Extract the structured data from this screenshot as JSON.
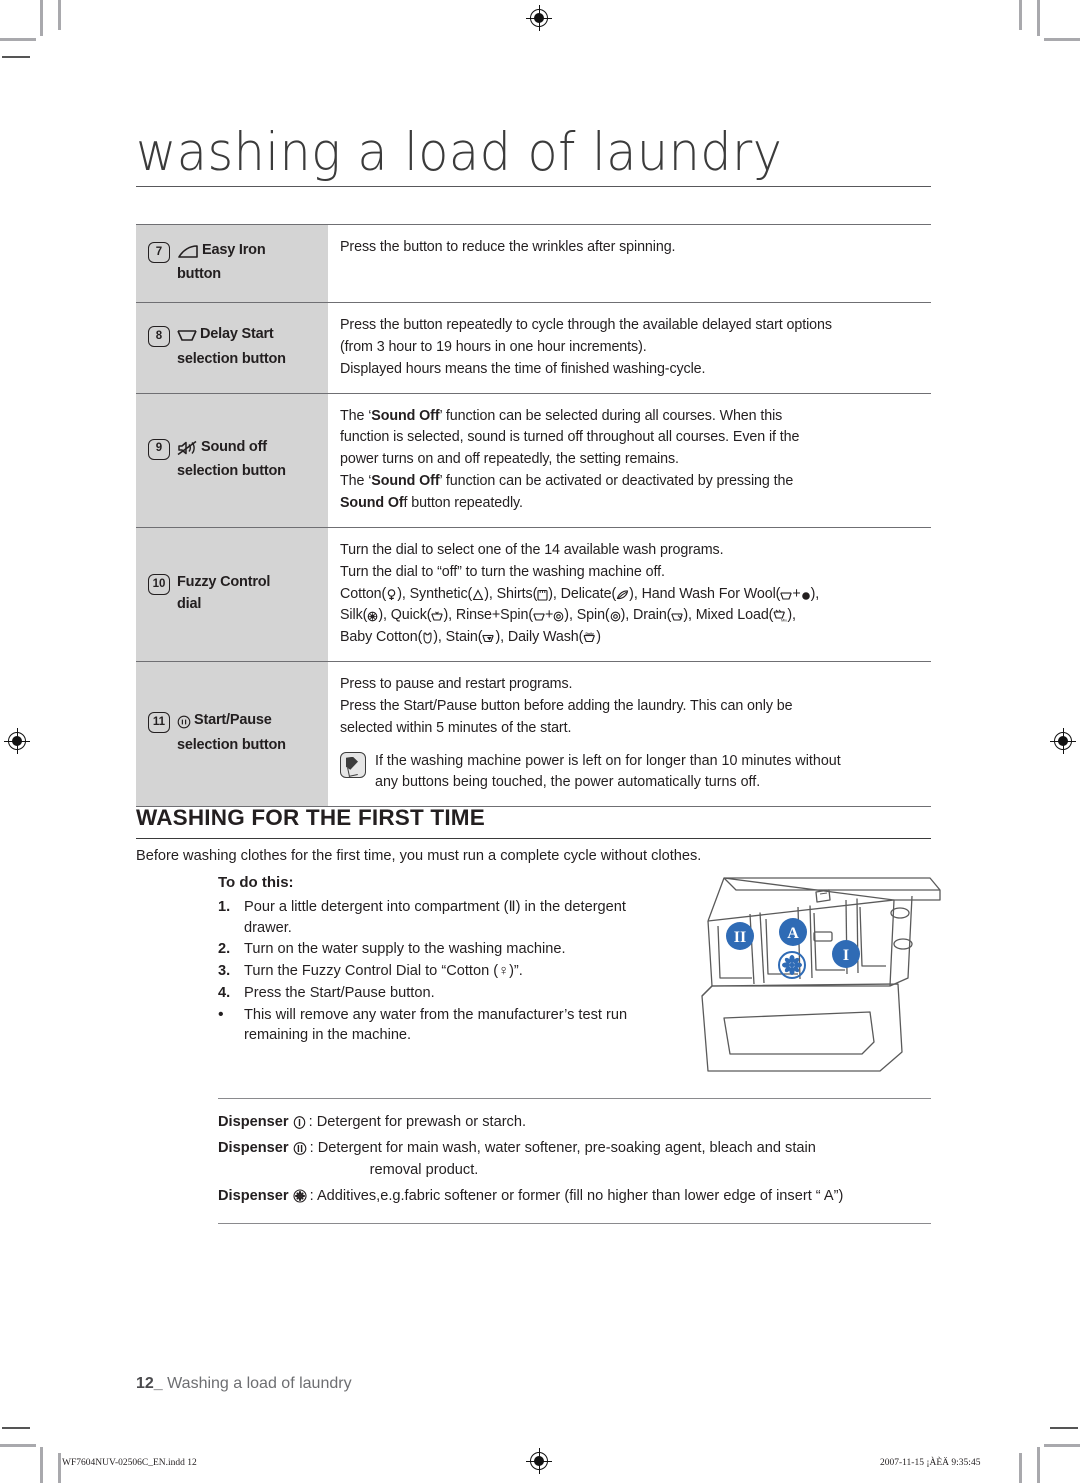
{
  "document": {
    "chapter_title": "washing a load of laundry",
    "folio_page": "12_",
    "folio_text": "Washing a load of laundry",
    "print_filename": "WF7604NUV-02506C_EN.indd   12",
    "print_timestamp": "2007-11-15   ¡ÀÈÄ 9:35:45"
  },
  "button_table": {
    "rows": [
      {
        "number": "7",
        "icon": "iron-icon",
        "label_line1": "Easy Iron",
        "label_line2": "button",
        "lines": [
          "Press the button to reduce the wrinkles after spinning."
        ]
      },
      {
        "number": "8",
        "icon": "delay-start-icon",
        "label_line1": "Delay Start",
        "label_line2": "selection button",
        "lines": [
          "Press the button repeatedly to cycle through the available delayed start options",
          "(from 3 hour to 19 hours in one hour increments).",
          "Displayed hours means the time of finished washing-cycle."
        ]
      },
      {
        "number": "9",
        "icon": "sound-off-icon",
        "label_line1": "Sound off",
        "label_line2": "selection button",
        "rich_lines": [
          "The ‘<b>Sound Off</b>’ function can be selected during all courses. When this",
          "function is selected, sound is turned off throughout all courses. Even if the",
          "power turns on and off repeatedly, the setting remains.",
          "The ‘<b>Sound Off</b>’ function can be activated or deactivated by pressing the",
          "<b>Sound Of</b>f button repeatedly."
        ]
      },
      {
        "number": "10",
        "icon": "",
        "label_line1": "Fuzzy Control",
        "label_line2": "dial",
        "lines": [
          "Turn the dial to select one of the 14 available wash programs.",
          "Turn the dial to “off” to turn the washing machine off."
        ],
        "programs_text": [
          "Cotton(♀), Synthetic(⚳), Shirts(⬜), Delicate(◢), Hand Wash For Wool(⬜+●),",
          "Silk(☸), Quick(⬜), Rinse+Spin(⬜+◎), Spin(◎), Drain(⬜), Mixed Load(⬜),",
          "Baby Cotton(⬜), Stain(⬜), Daily Wash(⬜)"
        ],
        "programs": [
          "Cotton",
          "Synthetic",
          "Shirts",
          "Delicate",
          "Hand Wash For Wool",
          "Silk",
          "Quick",
          "Rinse+Spin",
          "Spin",
          "Drain",
          "Mixed Load",
          "Baby Cotton",
          "Stain",
          "Daily Wash"
        ]
      },
      {
        "number": "11",
        "icon": "start-pause-icon",
        "label_line1": "Start/Pause",
        "label_line2": "selection button",
        "lines": [
          "Press to pause and restart programs.",
          "Press the Start/Pause button before adding the laundry. This can only be",
          "selected within 5 minutes of the start."
        ],
        "note": [
          "If the washing machine power is left on for longer than 10 minutes without",
          "any buttons being touched, the power automatically turns off."
        ]
      }
    ]
  },
  "first_time_section": {
    "heading": "WASHING FOR THE FIRST TIME",
    "intro": "Before washing clothes for the first time, you must run a complete cycle without clothes.",
    "todo_label": "To do this:",
    "steps": [
      {
        "marker": "1.",
        "line1": "Pour a little detergent into compartment (Ⅱ) in the detergent",
        "line2": "drawer."
      },
      {
        "marker": "2.",
        "line1": "Turn on the water supply to the washing machine.",
        "line2": ""
      },
      {
        "marker": "3.",
        "line1": "Turn the Fuzzy Control Dial to “Cotton (♀)”.",
        "line2": ""
      },
      {
        "marker": "4.",
        "line1": "Press the Start/Pause button.",
        "line2": ""
      },
      {
        "marker": "•",
        "line1": "This will remove any water from the manufacturer’s test run",
        "line2": "remaining in the machine."
      }
    ]
  },
  "drawer_illustration": {
    "labels": [
      "II",
      "A",
      "I"
    ],
    "softener_icon": "flower-icon",
    "accent_color": "#2f6bb5",
    "line_color": "#4a4a4a"
  },
  "dispenser_legend": {
    "rows": [
      {
        "label": "Dispenser",
        "symbol": "I",
        "text": ": Detergent for prewash or starch.",
        "indent": ""
      },
      {
        "label": "Dispenser",
        "symbol": "II",
        "text": ": Detergent for main wash, water softener, pre-soaking agent, bleach and stain",
        "indent": "removal product."
      },
      {
        "label": "Dispenser",
        "symbol": "flower",
        "text": ": Additives,e.g.fabric softener or former (fill no higher than lower edge of insert “ A”)",
        "indent": ""
      }
    ]
  }
}
